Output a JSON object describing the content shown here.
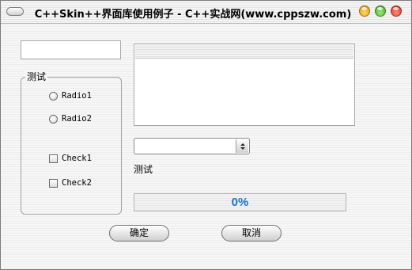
{
  "window": {
    "title": "C++Skin++界面库使用例子 - C++实战网(www.cppszw.com)"
  },
  "group": {
    "title": "测试",
    "radios": [
      {
        "label": "Radio1",
        "checked": false
      },
      {
        "label": "Radio2",
        "checked": false
      }
    ],
    "checkboxes": [
      {
        "label": "Check1",
        "checked": false
      },
      {
        "label": "Check2",
        "checked": false
      }
    ]
  },
  "edit": {
    "value": ""
  },
  "combo": {
    "selected": ""
  },
  "static_label": "测试",
  "progress": {
    "value": 0,
    "text": "0%"
  },
  "buttons": {
    "ok_label": "确定",
    "cancel_label": "取消"
  },
  "colors": {
    "progress_text": "#1a6fd1",
    "min_button": "#e8a317",
    "max_button": "#4fb52d",
    "close_button": "#e0402e"
  }
}
